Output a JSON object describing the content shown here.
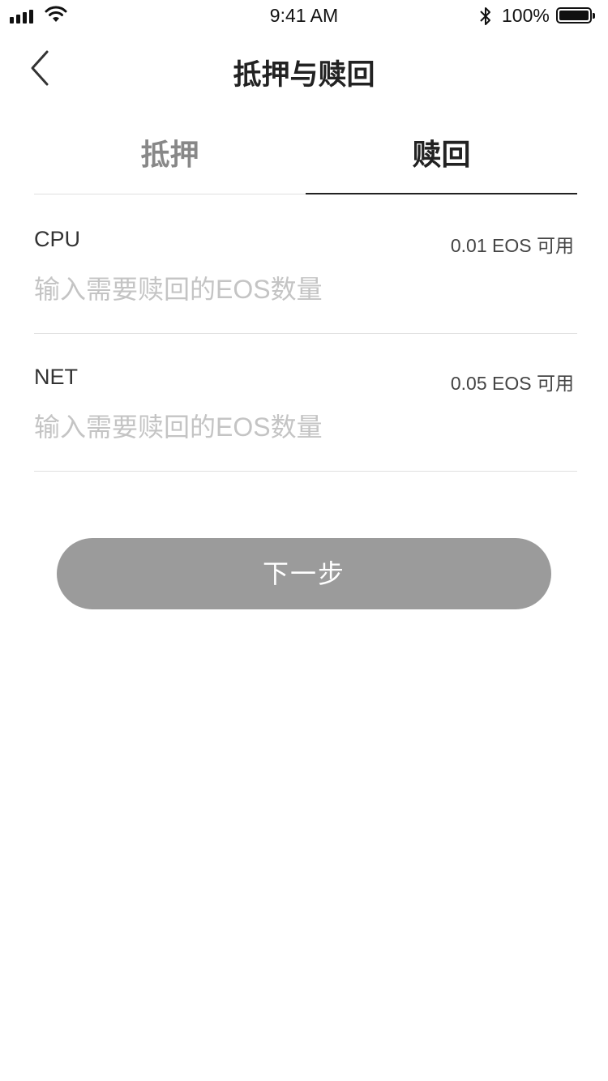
{
  "status_bar": {
    "time": "9:41 AM",
    "battery_percent": "100%",
    "battery_level": 1.0,
    "icons": [
      "signal-icon",
      "wifi-icon",
      "bluetooth-icon",
      "battery-icon"
    ]
  },
  "nav": {
    "title": "抵押与赎回",
    "back_icon": "chevron-left-icon"
  },
  "tabs": [
    {
      "label": "抵押",
      "active": false
    },
    {
      "label": "赎回",
      "active": true
    }
  ],
  "fields": {
    "cpu": {
      "label": "CPU",
      "available": "0.01 EOS  可用",
      "value": "",
      "placeholder": "输入需要赎回的EOS数量"
    },
    "net": {
      "label": "NET",
      "available": "0.05 EOS  可用",
      "value": "",
      "placeholder": "输入需要赎回的EOS数量"
    }
  },
  "next_button": {
    "label": "下一步"
  },
  "colors": {
    "active_tab": "#222222",
    "inactive_tab": "#888888",
    "button_disabled": "#9b9b9b",
    "placeholder": "#c4c4c4",
    "divider": "#e0e0e0"
  }
}
